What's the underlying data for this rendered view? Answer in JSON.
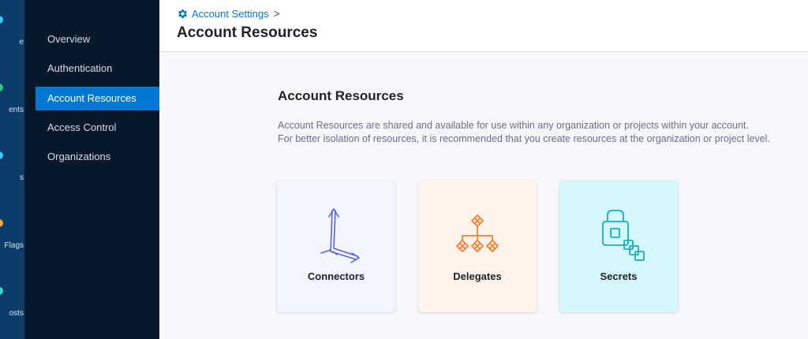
{
  "rail": {
    "items": [
      {
        "label": "e",
        "color": "#3dc7f6"
      },
      {
        "label": "ents",
        "color": "#30c48d"
      },
      {
        "label": "s",
        "color": "#3dc7f6"
      },
      {
        "label": "Flags",
        "color": "#f3a33b"
      },
      {
        "label": "osts",
        "color": "#3dd7c2"
      }
    ]
  },
  "sidebar": {
    "items": [
      {
        "label": "Overview"
      },
      {
        "label": "Authentication"
      },
      {
        "label": "Account Resources",
        "active": true
      },
      {
        "label": "Access Control"
      },
      {
        "label": "Organizations"
      }
    ]
  },
  "header": {
    "breadcrumb": "Account Settings",
    "breadcrumb_icon": "gear-icon",
    "separator": ">",
    "title": "Account Resources"
  },
  "main": {
    "title": "Account Resources",
    "description_line1": "Account Resources are shared and available for use within any organization or projects within your account.",
    "description_line2": "For better isolation of resources, it is recommended that you create resources at the organization or project level."
  },
  "cards": [
    {
      "label": "Connectors",
      "icon": "connectors-icon",
      "bg": "#f2f5fe",
      "color": "#5a63e4"
    },
    {
      "label": "Delegates",
      "icon": "delegates-icon",
      "bg": "#fff4ec",
      "color": "#ff7c2b"
    },
    {
      "label": "Secrets",
      "icon": "secrets-icon",
      "bg": "#d5f7fb",
      "color": "#11b3ba"
    }
  ],
  "colors": {
    "accent": "#0278d5",
    "sidebar_bg": "#07182b",
    "rail_bg": "#0b3c6a"
  }
}
